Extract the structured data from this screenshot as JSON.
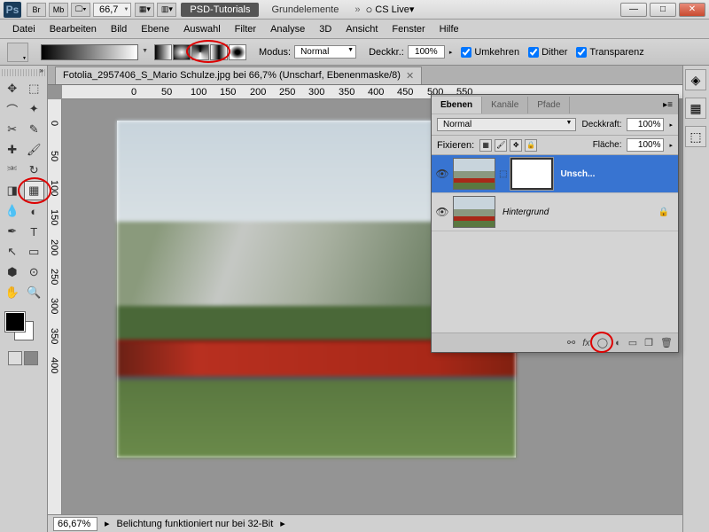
{
  "titlebar": {
    "zoom": "66,7",
    "tab_active": "PSD-Tutorials",
    "tab_inactive": "Grundelemente",
    "cslive": "CS Live"
  },
  "menu": [
    "Datei",
    "Bearbeiten",
    "Bild",
    "Ebene",
    "Auswahl",
    "Filter",
    "Analyse",
    "3D",
    "Ansicht",
    "Fenster",
    "Hilfe"
  ],
  "options": {
    "mode_label": "Modus:",
    "mode_value": "Normal",
    "opacity_label": "Deckkr.:",
    "opacity_value": "100%",
    "reverse": "Umkehren",
    "dither": "Dither",
    "trans": "Transparenz"
  },
  "doc_tab": "Fotolia_2957406_S_Mario Schulze.jpg bei 66,7%  (Unscharf, Ebenenmaske/8)",
  "layers": {
    "tab1": "Ebenen",
    "tab2": "Kanäle",
    "tab3": "Pfade",
    "blend_mode": "Normal",
    "opacity_label": "Deckkraft:",
    "opacity": "100%",
    "lock_label": "Fixieren:",
    "fill_label": "Fläche:",
    "fill": "100%",
    "layer1_name": "Unsch...",
    "layer2_name": "Hintergrund"
  },
  "ruler_h": [
    "0",
    "50",
    "100",
    "150",
    "200",
    "250",
    "300",
    "350",
    "400",
    "450",
    "500",
    "550"
  ],
  "ruler_v": [
    "0",
    "50",
    "100",
    "150",
    "200",
    "250",
    "300",
    "350",
    "400"
  ],
  "status": {
    "zoom": "66,67%",
    "info": "Belichtung funktioniert nur bei 32-Bit"
  }
}
